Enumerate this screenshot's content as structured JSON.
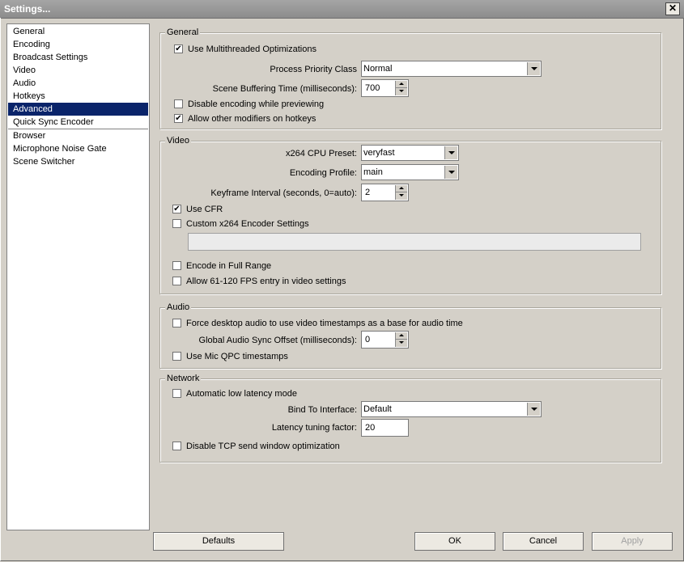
{
  "window": {
    "title": "Settings...",
    "close_glyph": "✕"
  },
  "sidebar": {
    "items": [
      "General",
      "Encoding",
      "Broadcast Settings",
      "Video",
      "Audio",
      "Hotkeys",
      "Advanced",
      "Quick Sync Encoder",
      "Browser",
      "Microphone Noise Gate",
      "Scene Switcher"
    ],
    "selected": "Advanced"
  },
  "general": {
    "group_label": "General",
    "use_multithreaded": {
      "label": "Use Multithreaded Optimizations",
      "checked": true
    },
    "process_priority": {
      "label": "Process Priority Class",
      "value": "Normal"
    },
    "scene_buffering": {
      "label": "Scene Buffering Time (milliseconds):",
      "value": "700"
    },
    "disable_encoding_preview": {
      "label": "Disable encoding while previewing",
      "checked": false
    },
    "allow_modifiers": {
      "label": "Allow other modifiers on hotkeys",
      "checked": true
    }
  },
  "video": {
    "group_label": "Video",
    "cpu_preset": {
      "label": "x264 CPU Preset:",
      "value": "veryfast"
    },
    "encoding_profile": {
      "label": "Encoding Profile:",
      "value": "main"
    },
    "keyframe_interval": {
      "label": "Keyframe Interval (seconds, 0=auto):",
      "value": "2"
    },
    "use_cfr": {
      "label": "Use CFR",
      "checked": true
    },
    "custom_x264": {
      "label": "Custom x264 Encoder Settings",
      "checked": false,
      "value": ""
    },
    "full_range": {
      "label": "Encode in Full Range",
      "checked": false
    },
    "allow_high_fps": {
      "label": "Allow 61-120 FPS entry in video settings",
      "checked": false
    }
  },
  "audio": {
    "group_label": "Audio",
    "force_desktop_timestamps": {
      "label": "Force desktop audio to use video timestamps as a base for audio time",
      "checked": false
    },
    "global_sync_offset": {
      "label": "Global Audio Sync Offset (milliseconds):",
      "value": "0"
    },
    "mic_qpc": {
      "label": "Use Mic QPC timestamps",
      "checked": false
    }
  },
  "network": {
    "group_label": "Network",
    "auto_low_latency": {
      "label": "Automatic low latency mode",
      "checked": false
    },
    "bind_interface": {
      "label": "Bind To Interface:",
      "value": "Default"
    },
    "latency_tuning": {
      "label": "Latency tuning factor:",
      "value": "20"
    },
    "disable_tcp_window": {
      "label": "Disable TCP send window optimization",
      "checked": false
    }
  },
  "buttons": {
    "defaults": "Defaults",
    "ok": "OK",
    "cancel": "Cancel",
    "apply": "Apply"
  },
  "colors": {
    "selection": "#0a246a",
    "dialog_bg": "#d4d0c8"
  }
}
